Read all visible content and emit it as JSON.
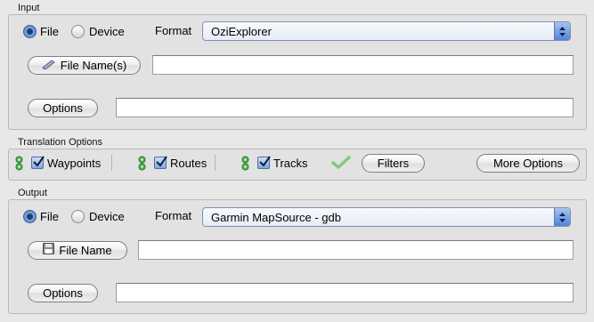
{
  "input": {
    "section_title": "Input",
    "file_label": "File",
    "device_label": "Device",
    "format_label": "Format",
    "format_value": "OziExplorer",
    "filename_button": "File Name(s)",
    "filename_value": "",
    "options_button": "Options",
    "options_value": ""
  },
  "translation": {
    "section_title": "Translation Options",
    "waypoints_label": "Waypoints",
    "routes_label": "Routes",
    "tracks_label": "Tracks",
    "filters_button": "Filters",
    "more_options_button": "More Options"
  },
  "output": {
    "section_title": "Output",
    "file_label": "File",
    "device_label": "Device",
    "format_label": "Format",
    "format_value": "Garmin MapSource - gdb",
    "filename_button": "File Name",
    "filename_value": "",
    "options_button": "Options",
    "options_value": ""
  },
  "state": {
    "input_file_selected": true,
    "output_file_selected": true,
    "waypoints_checked": true,
    "routes_checked": true,
    "tracks_checked": true
  },
  "icons": {
    "gear": "gear-icon",
    "filter_check": "checkmark-icon",
    "pencil": "pencil-icon",
    "disk": "floppy-disk-icon"
  },
  "colors": {
    "accent_blue": "#4e84d6",
    "gear_green": "#3fa83f"
  }
}
